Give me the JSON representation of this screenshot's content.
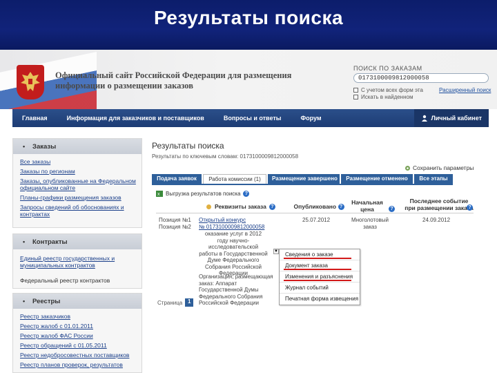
{
  "slide": {
    "title": "Результаты поиска"
  },
  "portal": {
    "site_title_line1": "Официальный сайт Российской Федерации для размещения",
    "site_title_line2": "информации о размещении заказов",
    "search_label": "ПОИСК ПО ЗАКАЗАМ",
    "search_value": "0173100009812000058",
    "check1": "С учетом всех форм эта",
    "check2": "Искать в найденном",
    "extended_search": "Расширенный поиск"
  },
  "nav": {
    "items": [
      "Главная",
      "Информация для заказчиков и поставщиков",
      "Вопросы и ответы",
      "Форум"
    ],
    "cabinet": "Личный кабинет"
  },
  "sidebar": {
    "orders": {
      "title": "Заказы",
      "links": [
        "Все заказы",
        "Заказы по регионам",
        "Заказы, опубликованные на Федеральном официальном сайте",
        "Планы-графики размещения заказов",
        "Запросы сведений об обоснованиях и контрактах"
      ]
    },
    "contracts": {
      "title": "Контракты",
      "links": [
        "Единый реестр государственных и муниципальных контрактов"
      ],
      "texts": [
        "Федеральный реестр контрактов"
      ]
    },
    "registries": {
      "title": "Реестры",
      "links": [
        "Реестр заказчиков",
        "Реестр жалоб с 01.01.2011",
        "Реестр жалоб ФАС России",
        "Реестр обращений с 01.05.2011",
        "Реестр недобросовестных поставщиков",
        "Реестр планов проверок, результатов"
      ]
    }
  },
  "main": {
    "title": "Результаты поиска",
    "subtitle": "Результаты по ключевым словам: 0173100009812000058",
    "return_link": "Сохранить параметры",
    "tabs": [
      "Подача заявок",
      "Работа комиссии (1)",
      "Размещение завершено",
      "Размещение отменено",
      "Все этапы"
    ],
    "export": "Выгрузка результатов поиска",
    "headers": {
      "requisites": "Реквизиты заказа",
      "published": "Опубликовано",
      "price": "Начальная цена",
      "last_event": "Последнее событие при размещении заказа"
    },
    "row": {
      "lot1": "Позиция №1",
      "lot2": "Позиция №2",
      "type": "Открытый конкурс",
      "number": "№ 0173100009812000058",
      "description": "оказание услуг в 2012 году научно-исследовательской работы в Государственной Думе Федерального Собрания Российской Федерации",
      "org": "Организация, размещающая заказ: Аппарат Государственной Думы Федерального Собрания Российской Федерации",
      "published": "25.07.2012",
      "price": "Многолотовый заказ",
      "event_date": "24.09.2012"
    },
    "dropdown": [
      "Сведения о заказе",
      "Документ заказа",
      "Изменения и разъяснения",
      "Журнал событий",
      "Печатная форма извещения"
    ],
    "pager_label": "Страница",
    "page": "1"
  }
}
